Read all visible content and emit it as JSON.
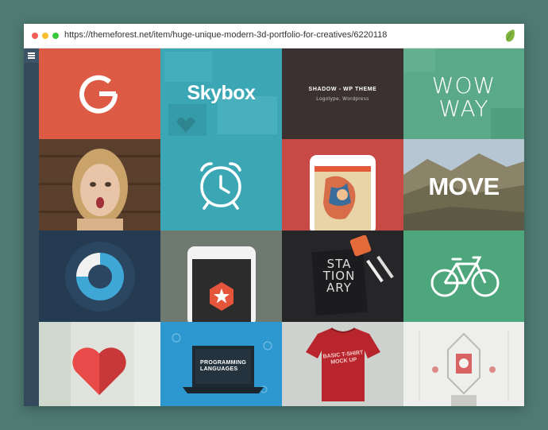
{
  "browser": {
    "url": "https://themeforest.net/item/huge-unique-modern-3d-portfolio-for-creatives/6220118",
    "leaf_icon": "envato-leaf-icon"
  },
  "sidebar": {
    "menu_icon": "hamburger-menu-icon"
  },
  "tiles": {
    "skybox": {
      "label": "Skybox"
    },
    "shadow": {
      "title": "SHADOW - WP THEME",
      "subtitle": "Logotype, Wordpress"
    },
    "wowway": {
      "line1": "WOW",
      "line2": "WAY"
    },
    "move": {
      "label": "MOVE"
    },
    "stationary": {
      "line1": "STA",
      "line2": "TION",
      "line3": "ARY"
    },
    "programming": {
      "line1": "PROGRAMMING",
      "line2": "LANGUAGES"
    },
    "tshirt": {
      "line1": "BASIC T-SHIRT",
      "line2": "MOCK UP"
    }
  },
  "colors": {
    "background": "#4e7a72",
    "sidebar": "#34495b",
    "red_tile": "#dd5a45",
    "teal_tile": "#3ba7b5",
    "dark_tile": "#3a3130",
    "green_tile": "#4ea77c"
  }
}
